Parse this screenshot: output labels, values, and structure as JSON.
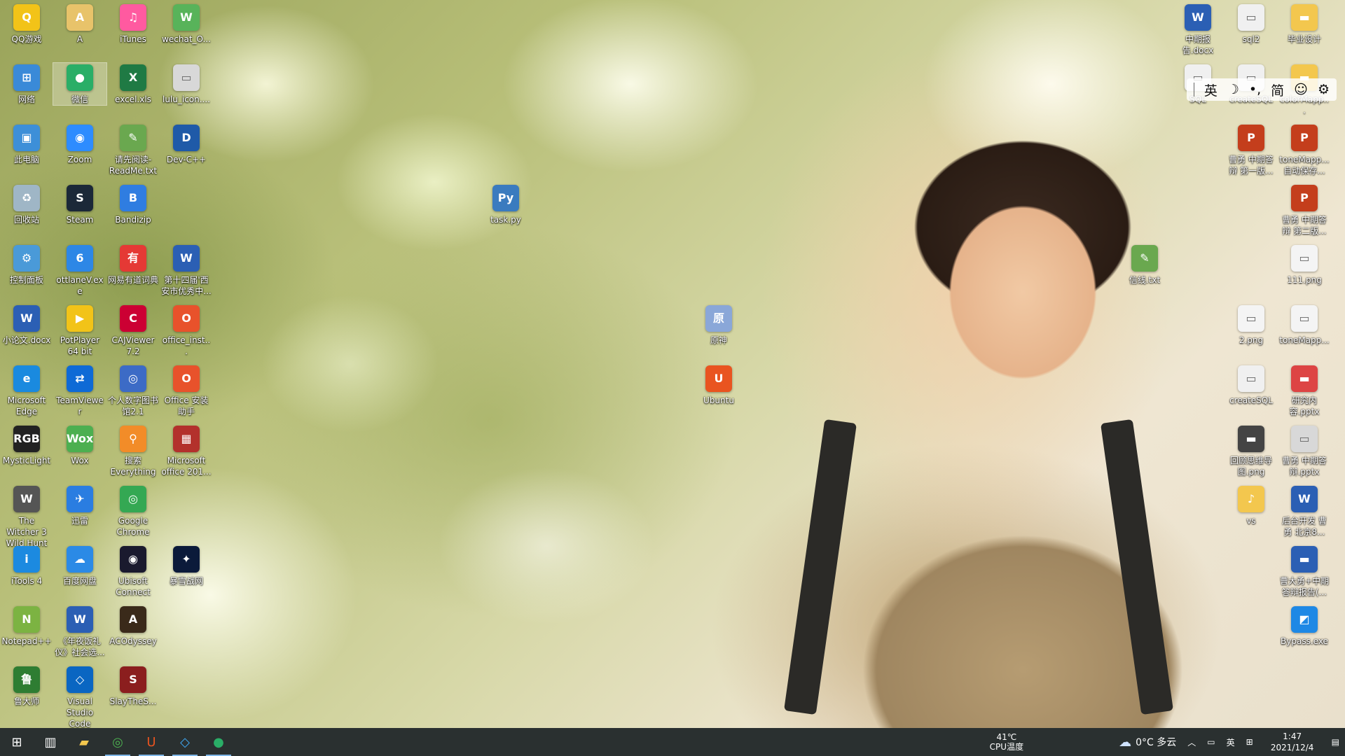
{
  "desktop_icons": [
    {
      "id": "qq",
      "label": "QQ游戏",
      "color": "#f2c318",
      "glyph": "Q"
    },
    {
      "id": "a",
      "label": "A",
      "color": "#e8c36a",
      "glyph": "A"
    },
    {
      "id": "itunes",
      "label": "iTunes",
      "color": "#ff5aa0",
      "glyph": "♫"
    },
    {
      "id": "wechat_o",
      "label": "wechat_O...",
      "color": "#58b35a",
      "glyph": "W"
    },
    {
      "id": "network",
      "label": "网络",
      "color": "#3a8ad8",
      "glyph": "⊞"
    },
    {
      "id": "weixin",
      "label": "微信",
      "color": "#2aae67",
      "glyph": "●"
    },
    {
      "id": "excel",
      "label": "excel.xls",
      "color": "#1f7a44",
      "glyph": "X"
    },
    {
      "id": "lulu",
      "label": "lulu_icon....",
      "color": "#d8d8d8",
      "glyph": "▭"
    },
    {
      "id": "thispc",
      "label": "此电脑",
      "color": "#3d8fd8",
      "glyph": "▣"
    },
    {
      "id": "zoom",
      "label": "Zoom",
      "color": "#2d8cff",
      "glyph": "◉"
    },
    {
      "id": "readme",
      "label": "请先阅读-ReadMe.txt",
      "color": "#6aa84f",
      "glyph": "✎"
    },
    {
      "id": "devcpp",
      "label": "Dev-C++",
      "color": "#1f5aa8",
      "glyph": "D"
    },
    {
      "id": "recycle",
      "label": "回收站",
      "color": "#9fb6c6",
      "glyph": "♻"
    },
    {
      "id": "steam",
      "label": "Steam",
      "color": "#1b2838",
      "glyph": "S"
    },
    {
      "id": "bandizip",
      "label": "Bandizip",
      "color": "#2f7de1",
      "glyph": "B"
    },
    {
      "id": "taskpy",
      "label": "task.py",
      "color": "#3a7bbf",
      "glyph": "Py"
    },
    {
      "id": "control",
      "label": "控制面板",
      "color": "#4a9ad8",
      "glyph": "⚙"
    },
    {
      "id": "ottlane",
      "label": "ottlaneV.exe",
      "color": "#2d87e6",
      "glyph": "6"
    },
    {
      "id": "youdao",
      "label": "网易有道词典",
      "color": "#e53935",
      "glyph": "有"
    },
    {
      "id": "xian",
      "label": "第十四届'西安市优秀中...",
      "color": "#2b5fb4",
      "glyph": "W"
    },
    {
      "id": "xiaolunwen",
      "label": "小论文.docx",
      "color": "#2b5fb4",
      "glyph": "W"
    },
    {
      "id": "potplayer",
      "label": "PotPlayer 64 bit",
      "color": "#f2c318",
      "glyph": "▶"
    },
    {
      "id": "cajviewer",
      "label": "CAJViewer 7.2",
      "color": "#c03",
      "glyph": "C"
    },
    {
      "id": "office_inst",
      "label": "office_inst...",
      "color": "#e8522b",
      "glyph": "O"
    },
    {
      "id": "yuanshen",
      "label": "原神",
      "color": "#8aa7d8",
      "glyph": "原"
    },
    {
      "id": "edge",
      "label": "Microsoft Edge",
      "color": "#1a8adf",
      "glyph": "e"
    },
    {
      "id": "teamviewer",
      "label": "TeamViewer",
      "color": "#0e6ad6",
      "glyph": "⇄"
    },
    {
      "id": "library",
      "label": "个人数字图书馆2.1",
      "color": "#3c6bc6",
      "glyph": "◎"
    },
    {
      "id": "officehelper",
      "label": "Office 安装助手",
      "color": "#e8522b",
      "glyph": "O"
    },
    {
      "id": "ubuntu",
      "label": "Ubuntu",
      "color": "#e95420",
      "glyph": "U"
    },
    {
      "id": "mysticlight",
      "label": "MysticLight",
      "color": "#222",
      "glyph": "RGB"
    },
    {
      "id": "wox",
      "label": "Wox",
      "color": "#4caf50",
      "glyph": "Wox"
    },
    {
      "id": "everything",
      "label": "搜索 Everything",
      "color": "#f28c28",
      "glyph": "⚲"
    },
    {
      "id": "office2010",
      "label": "Microsoft office 201...",
      "color": "#b3312c",
      "glyph": "▦"
    },
    {
      "id": "witcher",
      "label": "The Witcher 3 Wild Hunt",
      "color": "#555",
      "glyph": "W"
    },
    {
      "id": "xunlei",
      "label": "迅雷",
      "color": "#2a7de1",
      "glyph": "✈"
    },
    {
      "id": "chrome",
      "label": "Google Chrome",
      "color": "#34a853",
      "glyph": "◎"
    },
    {
      "id": "itools",
      "label": "iTools 4",
      "color": "#1c8ae0",
      "glyph": "i"
    },
    {
      "id": "baiduyun",
      "label": "百度网盘",
      "color": "#2b8ae6",
      "glyph": "☁"
    },
    {
      "id": "ubisoft",
      "label": "Ubisoft Connect",
      "color": "#1a1a2e",
      "glyph": "◉"
    },
    {
      "id": "battlenet",
      "label": "暴雪战网",
      "color": "#0b1a3a",
      "glyph": "✦"
    },
    {
      "id": "notepadpp",
      "label": "Notepad++",
      "color": "#7cb342",
      "glyph": "N"
    },
    {
      "id": "nianye",
      "label": "《年夜饭礼仪》社会选...",
      "color": "#2b5fb4",
      "glyph": "W"
    },
    {
      "id": "acodyssey",
      "label": "ACOdyssey",
      "color": "#3a2a1a",
      "glyph": "A"
    },
    {
      "id": "ludashi",
      "label": "鲁大师",
      "color": "#2e7d32",
      "glyph": "鲁"
    },
    {
      "id": "vscode",
      "label": "Visual Studio Code",
      "color": "#0a66c2",
      "glyph": "◇"
    },
    {
      "id": "slaythespire",
      "label": "SlayTheS...",
      "color": "#8b1e1e",
      "glyph": "S"
    },
    {
      "id": "zhongqi",
      "label": "中期报告.docx",
      "color": "#2b5fb4",
      "glyph": "W"
    },
    {
      "id": "sql2",
      "label": "sql2",
      "color": "#f0f0f0",
      "glyph": "▭"
    },
    {
      "id": "biye",
      "label": "毕业设计",
      "color": "#f3c74e",
      "glyph": "▬"
    },
    {
      "id": "sql",
      "label": "SQL",
      "color": "#f0f0f0",
      "glyph": "▭"
    },
    {
      "id": "createsql2",
      "label": "createSQL",
      "color": "#f0f0f0",
      "glyph": "▭"
    },
    {
      "id": "colormap",
      "label": "colorMapp...",
      "color": "#f3c74e",
      "glyph": "▬"
    },
    {
      "id": "ppt1",
      "label": "曹勇 中期答辩 第一版...",
      "color": "#c43e1c",
      "glyph": "P"
    },
    {
      "id": "tonemap1",
      "label": "toneMapp... 自动保存...",
      "color": "#c43e1c",
      "glyph": "P"
    },
    {
      "id": "ppt2",
      "label": "曹勇 中期答辩 第二版...",
      "color": "#c43e1c",
      "glyph": "P"
    },
    {
      "id": "xinjian",
      "label": "信线.txt",
      "color": "#6aa84f",
      "glyph": "✎"
    },
    {
      "id": "png111",
      "label": "111.png",
      "color": "#f4f4f4",
      "glyph": "▭"
    },
    {
      "id": "png2",
      "label": "2.png",
      "color": "#f4f4f4",
      "glyph": "▭"
    },
    {
      "id": "tonemap2",
      "label": "toneMapp...",
      "color": "#f4f4f4",
      "glyph": "▭"
    },
    {
      "id": "createsql",
      "label": "createSQL",
      "color": "#f0f0f0",
      "glyph": "▭"
    },
    {
      "id": "yanjiu",
      "label": "研究内容.pptx",
      "color": "#d44",
      "glyph": "▬"
    },
    {
      "id": "huixiang",
      "label": "回顾思维导图.png",
      "color": "#444",
      "glyph": "▬"
    },
    {
      "id": "ppt3",
      "label": "曹勇 中期答辩.pptx",
      "color": "#d8d8d8",
      "glyph": "▭"
    },
    {
      "id": "vs",
      "label": "vs",
      "color": "#f3c74e",
      "glyph": "♪"
    },
    {
      "id": "houtai",
      "label": "后台开发 曹勇 北京8...",
      "color": "#2b5fb4",
      "glyph": "W"
    },
    {
      "id": "caoyong",
      "label": "曹大勇+中期答辩报告(...",
      "color": "#2b5fb4",
      "glyph": "▬"
    },
    {
      "id": "bypass",
      "label": "Bypass.exe",
      "color": "#1e88e5",
      "glyph": "◩"
    }
  ],
  "ime_bar": {
    "lang": "英",
    "moon": "☽",
    "punct": "•,",
    "simplified": "简",
    "emoji": "☺",
    "settings": "⚙"
  },
  "taskbar": {
    "apps": [
      {
        "name": "start",
        "glyph": "⊞"
      },
      {
        "name": "task-view",
        "glyph": "▥"
      },
      {
        "name": "file-explorer",
        "glyph": "▰"
      },
      {
        "name": "chrome",
        "glyph": "◎"
      },
      {
        "name": "ubuntu",
        "glyph": "U"
      },
      {
        "name": "vscode",
        "glyph": "◇"
      },
      {
        "name": "wechat",
        "glyph": "●"
      }
    ],
    "cpu_temp": "41℃",
    "cpu_label": "CPU温度",
    "weather": "0°C 多云",
    "tray_lang": "英",
    "time": "1:47",
    "date": "2021/12/4"
  }
}
